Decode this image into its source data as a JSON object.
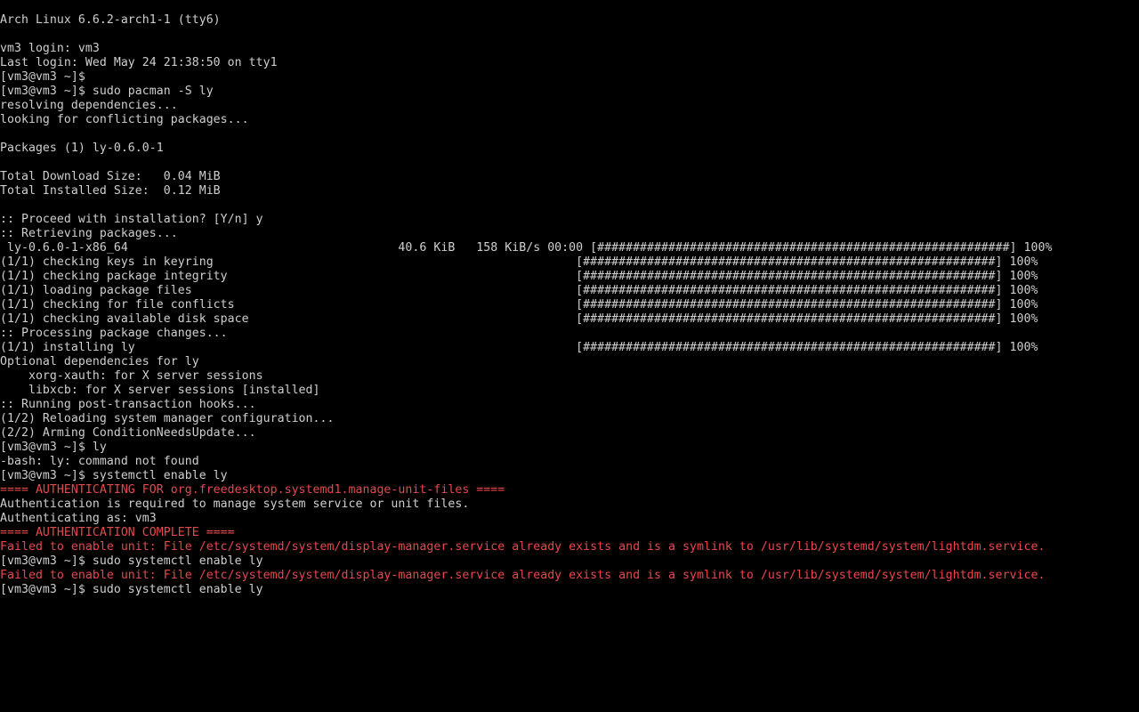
{
  "terminal": {
    "colors": {
      "background": "#000000",
      "foreground": "#cfcfcf",
      "error": "#e8484d"
    },
    "lines": [
      {
        "text": "Arch Linux 6.6.2-arch1-1 (tty6)",
        "color": "normal"
      },
      {
        "text": "",
        "color": "normal"
      },
      {
        "text": "vm3 login: vm3",
        "color": "normal"
      },
      {
        "text": "Last login: Wed May 24 21:38:50 on tty1",
        "color": "normal"
      },
      {
        "text": "[vm3@vm3 ~]$",
        "color": "normal"
      },
      {
        "text": "[vm3@vm3 ~]$ sudo pacman -S ly",
        "color": "normal"
      },
      {
        "text": "resolving dependencies...",
        "color": "normal"
      },
      {
        "text": "looking for conflicting packages...",
        "color": "normal"
      },
      {
        "text": "",
        "color": "normal"
      },
      {
        "text": "Packages (1) ly-0.6.0-1",
        "color": "normal"
      },
      {
        "text": "",
        "color": "normal"
      },
      {
        "text": "Total Download Size:   0.04 MiB",
        "color": "normal"
      },
      {
        "text": "Total Installed Size:  0.12 MiB",
        "color": "normal"
      },
      {
        "text": "",
        "color": "normal"
      },
      {
        "text": ":: Proceed with installation? [Y/n] y",
        "color": "normal"
      },
      {
        "text": ":: Retrieving packages...",
        "color": "normal"
      },
      {
        "text": " ly-0.6.0-1-x86_64                                      40.6 KiB   158 KiB/s 00:00 [##########################################################] 100%",
        "color": "normal"
      },
      {
        "text": "(1/1) checking keys in keyring                                                   [##########################################################] 100%",
        "color": "normal"
      },
      {
        "text": "(1/1) checking package integrity                                                 [##########################################################] 100%",
        "color": "normal"
      },
      {
        "text": "(1/1) loading package files                                                      [##########################################################] 100%",
        "color": "normal"
      },
      {
        "text": "(1/1) checking for file conflicts                                                [##########################################################] 100%",
        "color": "normal"
      },
      {
        "text": "(1/1) checking available disk space                                              [##########################################################] 100%",
        "color": "normal"
      },
      {
        "text": ":: Processing package changes...",
        "color": "normal"
      },
      {
        "text": "(1/1) installing ly                                                              [##########################################################] 100%",
        "color": "normal"
      },
      {
        "text": "Optional dependencies for ly",
        "color": "normal"
      },
      {
        "text": "    xorg-xauth: for X server sessions",
        "color": "normal"
      },
      {
        "text": "    libxcb: for X server sessions [installed]",
        "color": "normal"
      },
      {
        "text": ":: Running post-transaction hooks...",
        "color": "normal"
      },
      {
        "text": "(1/2) Reloading system manager configuration...",
        "color": "normal"
      },
      {
        "text": "(2/2) Arming ConditionNeedsUpdate...",
        "color": "normal"
      },
      {
        "text": "[vm3@vm3 ~]$ ly",
        "color": "normal"
      },
      {
        "text": "-bash: ly: command not found",
        "color": "normal"
      },
      {
        "text": "[vm3@vm3 ~]$ systemctl enable ly",
        "color": "normal"
      },
      {
        "text": "==== AUTHENTICATING FOR org.freedesktop.systemd1.manage-unit-files ====",
        "color": "red"
      },
      {
        "text": "Authentication is required to manage system service or unit files.",
        "color": "normal"
      },
      {
        "text": "Authenticating as: vm3",
        "color": "normal"
      },
      {
        "text": "==== AUTHENTICATION COMPLETE ====",
        "color": "red"
      },
      {
        "text": "Failed to enable unit: File /etc/systemd/system/display-manager.service already exists and is a symlink to /usr/lib/systemd/system/lightdm.service.",
        "color": "red"
      },
      {
        "text": "[vm3@vm3 ~]$ sudo systemctl enable ly",
        "color": "normal"
      },
      {
        "text": "Failed to enable unit: File /etc/systemd/system/display-manager.service already exists and is a symlink to /usr/lib/systemd/system/lightdm.service.",
        "color": "red"
      },
      {
        "text": "[vm3@vm3 ~]$ sudo systemctl enable ly",
        "color": "normal"
      }
    ]
  }
}
